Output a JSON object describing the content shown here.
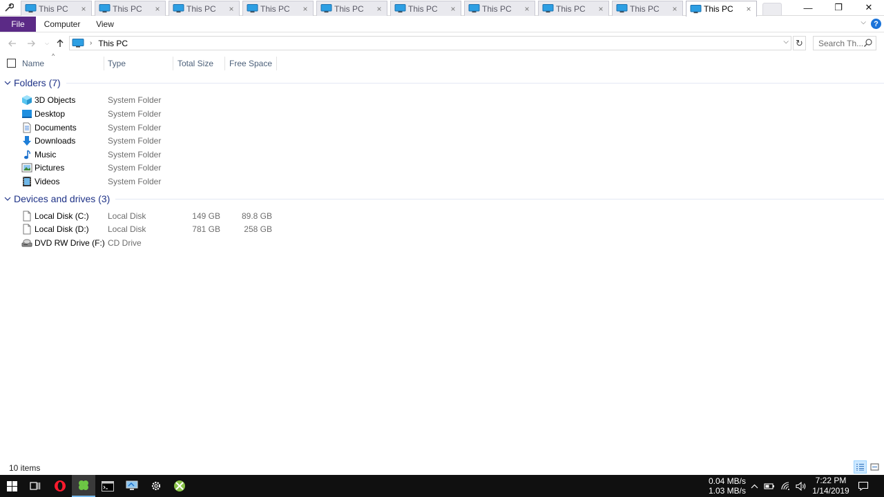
{
  "tabs": [
    {
      "label": "This PC",
      "close": "×"
    },
    {
      "label": "This PC",
      "close": "×"
    },
    {
      "label": "This PC",
      "close": "×"
    },
    {
      "label": "This PC",
      "close": "×"
    },
    {
      "label": "This PC",
      "close": "×"
    },
    {
      "label": "This PC",
      "close": "×"
    },
    {
      "label": "This PC",
      "close": "×"
    },
    {
      "label": "This PC",
      "close": "×"
    },
    {
      "label": "This PC",
      "close": "×"
    },
    {
      "label": "This PC",
      "close": "×",
      "active": true
    }
  ],
  "window_controls": {
    "minimize": "—",
    "restore": "❐",
    "close": "✕"
  },
  "ribbon": {
    "file": "File",
    "computer": "Computer",
    "view": "View",
    "help": "?"
  },
  "address": {
    "crumb": "This PC",
    "search_placeholder": "Search Th..."
  },
  "columns": {
    "name": "Name",
    "type": "Type",
    "total_size": "Total Size",
    "free_space": "Free Space"
  },
  "groups": {
    "folders": {
      "title": "Folders (7)",
      "items": [
        {
          "name": "3D Objects",
          "type": "System Folder",
          "icon": "3d-objects-icon"
        },
        {
          "name": "Desktop",
          "type": "System Folder",
          "icon": "desktop-folder-icon"
        },
        {
          "name": "Documents",
          "type": "System Folder",
          "icon": "documents-icon"
        },
        {
          "name": "Downloads",
          "type": "System Folder",
          "icon": "downloads-icon"
        },
        {
          "name": "Music",
          "type": "System Folder",
          "icon": "music-icon"
        },
        {
          "name": "Pictures",
          "type": "System Folder",
          "icon": "pictures-icon"
        },
        {
          "name": "Videos",
          "type": "System Folder",
          "icon": "videos-icon"
        }
      ]
    },
    "drives": {
      "title": "Devices and drives (3)",
      "items": [
        {
          "name": "Local Disk (C:)",
          "type": "Local Disk",
          "total_size": "149 GB",
          "free_space": "89.8 GB",
          "icon": "drive-icon"
        },
        {
          "name": "Local Disk (D:)",
          "type": "Local Disk",
          "total_size": "781 GB",
          "free_space": "258 GB",
          "icon": "drive-icon"
        },
        {
          "name": "DVD RW Drive (F:)",
          "type": "CD Drive",
          "total_size": "",
          "free_space": "",
          "icon": "dvd-drive-icon"
        }
      ]
    }
  },
  "status": {
    "item_count": "10 items"
  },
  "taskbar": {
    "net_up": "0.04 MB/s",
    "net_down": "1.03 MB/s",
    "time": "7:22 PM",
    "date": "1/14/2019"
  },
  "colors": {
    "file_tab": "#5b2a86",
    "group_title": "#1e3287",
    "taskbar": "#101010"
  }
}
